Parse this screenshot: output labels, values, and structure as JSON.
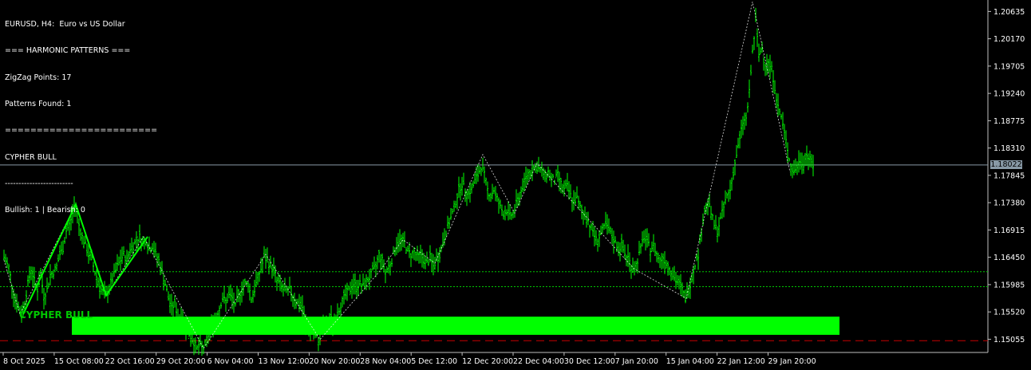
{
  "info": {
    "lines": [
      "EURUSD, H4:  Euro vs US Dollar",
      "=== HARMONIC PATTERNS ===",
      "ZigZag Points: 17",
      "Patterns Found: 1",
      "========================",
      "CYPHER BULL",
      "-------------------------",
      "Bullish: 1 | Bearish: 0"
    ]
  },
  "pattern": {
    "label": "CYPHER BULL"
  },
  "current_price": "1.18022",
  "y_axis": {
    "labels": [
      "1.20635",
      "1.20170",
      "1.19705",
      "1.19240",
      "1.18775",
      "1.18310",
      "1.17845",
      "1.17380",
      "1.16915",
      "1.16450",
      "1.15985",
      "1.15520",
      "1.15055"
    ]
  },
  "x_axis": {
    "labels": [
      "8 Oct 2025",
      "15 Oct 08:00",
      "22 Oct 16:00",
      "29 Oct 20:00",
      "6 Nov 04:00",
      "13 Nov 12:00",
      "20 Nov 20:00",
      "28 Nov 04:00",
      "5 Dec 12:00",
      "12 Dec 20:00",
      "22 Dec 04:00",
      "30 Dec 12:00",
      "7 Jan 20:00",
      "15 Jan 04:00",
      "22 Jan 12:00",
      "29 Jan 20:00"
    ]
  },
  "colors": {
    "background": "#000000",
    "bars": "#00ff00",
    "zone": "#00ff00",
    "dotted_levels": "#00c800",
    "sl_line": "#c80000",
    "price_line": "#8899a6",
    "zigzag": "#ffffff"
  },
  "chart_data": {
    "type": "candlestick",
    "symbol": "EURUSD",
    "timeframe": "H4",
    "ylim": [
      1.1483,
      1.2083
    ],
    "path": [
      [
        0,
        1.1645
      ],
      [
        6,
        1.1628
      ],
      [
        10,
        1.1598
      ],
      [
        14,
        1.1572
      ],
      [
        18,
        1.156
      ],
      [
        22,
        1.1548
      ],
      [
        26,
        1.1568
      ],
      [
        30,
        1.16
      ],
      [
        34,
        1.1625
      ],
      [
        38,
        1.1605
      ],
      [
        42,
        1.159
      ],
      [
        46,
        1.1615
      ],
      [
        50,
        1.158
      ],
      [
        54,
        1.159
      ],
      [
        58,
        1.1615
      ],
      [
        62,
        1.162
      ],
      [
        66,
        1.163
      ],
      [
        70,
        1.165
      ],
      [
        74,
        1.166
      ],
      [
        78,
        1.169
      ],
      [
        82,
        1.17
      ],
      [
        86,
        1.172
      ],
      [
        90,
        1.1735
      ],
      [
        94,
        1.17
      ],
      [
        98,
        1.168
      ],
      [
        102,
        1.1665
      ],
      [
        106,
        1.165
      ],
      [
        110,
        1.164
      ],
      [
        114,
        1.162
      ],
      [
        118,
        1.1605
      ],
      [
        122,
        1.159
      ],
      [
        126,
        1.158
      ],
      [
        130,
        1.1585
      ],
      [
        134,
        1.16
      ],
      [
        138,
        1.1615
      ],
      [
        142,
        1.163
      ],
      [
        146,
        1.164
      ],
      [
        150,
        1.165
      ],
      [
        154,
        1.164
      ],
      [
        158,
        1.166
      ],
      [
        162,
        1.1665
      ],
      [
        166,
        1.1675
      ],
      [
        170,
        1.168
      ],
      [
        174,
        1.167
      ],
      [
        178,
        1.1675
      ],
      [
        182,
        1.166
      ],
      [
        186,
        1.1665
      ],
      [
        190,
        1.165
      ],
      [
        194,
        1.164
      ],
      [
        198,
        1.162
      ],
      [
        202,
        1.16
      ],
      [
        206,
        1.1575
      ],
      [
        210,
        1.156
      ],
      [
        214,
        1.1565
      ],
      [
        218,
        1.1545
      ],
      [
        222,
        1.1545
      ],
      [
        226,
        1.153
      ],
      [
        230,
        1.152
      ],
      [
        234,
        1.151
      ],
      [
        238,
        1.15
      ],
      [
        242,
        1.149
      ],
      [
        246,
        1.1495
      ],
      [
        250,
        1.149
      ],
      [
        254,
        1.1505
      ],
      [
        258,
        1.152
      ],
      [
        262,
        1.1535
      ],
      [
        266,
        1.1545
      ],
      [
        270,
        1.156
      ],
      [
        274,
        1.1575
      ],
      [
        278,
        1.157
      ],
      [
        282,
        1.158
      ],
      [
        286,
        1.1575
      ],
      [
        290,
        1.156
      ],
      [
        294,
        1.158
      ],
      [
        298,
        1.159
      ],
      [
        302,
        1.16
      ],
      [
        306,
        1.16
      ],
      [
        310,
        1.1575
      ],
      [
        314,
        1.159
      ],
      [
        318,
        1.161
      ],
      [
        322,
        1.1625
      ],
      [
        326,
        1.1645
      ],
      [
        330,
        1.164
      ],
      [
        334,
        1.163
      ],
      [
        338,
        1.1625
      ],
      [
        342,
        1.1605
      ],
      [
        346,
        1.16
      ],
      [
        350,
        1.159
      ],
      [
        354,
        1.1585
      ],
      [
        358,
        1.159
      ],
      [
        362,
        1.158
      ],
      [
        366,
        1.157
      ],
      [
        370,
        1.1565
      ],
      [
        374,
        1.156
      ],
      [
        378,
        1.153
      ],
      [
        382,
        1.152
      ],
      [
        386,
        1.1525
      ],
      [
        390,
        1.151
      ],
      [
        394,
        1.1505
      ],
      [
        398,
        1.152
      ],
      [
        402,
        1.153
      ],
      [
        406,
        1.1525
      ],
      [
        410,
        1.154
      ],
      [
        414,
        1.153
      ],
      [
        418,
        1.155
      ],
      [
        422,
        1.1565
      ],
      [
        426,
        1.1575
      ],
      [
        430,
        1.1585
      ],
      [
        434,
        1.159
      ],
      [
        438,
        1.16
      ],
      [
        442,
        1.1595
      ],
      [
        446,
        1.16
      ],
      [
        450,
        1.1595
      ],
      [
        454,
        1.1605
      ],
      [
        458,
        1.161
      ],
      [
        462,
        1.162
      ],
      [
        466,
        1.163
      ],
      [
        470,
        1.165
      ],
      [
        474,
        1.164
      ],
      [
        478,
        1.162
      ],
      [
        482,
        1.163
      ],
      [
        486,
        1.164
      ],
      [
        490,
        1.166
      ],
      [
        494,
        1.167
      ],
      [
        498,
        1.1675
      ],
      [
        502,
        1.167
      ],
      [
        506,
        1.1655
      ],
      [
        510,
        1.165
      ],
      [
        514,
        1.1655
      ],
      [
        518,
        1.1645
      ],
      [
        522,
        1.165
      ],
      [
        526,
        1.164
      ],
      [
        530,
        1.1635
      ],
      [
        534,
        1.1645
      ],
      [
        538,
        1.163
      ],
      [
        542,
        1.164
      ],
      [
        546,
        1.165
      ],
      [
        550,
        1.167
      ],
      [
        554,
        1.169
      ],
      [
        558,
        1.1705
      ],
      [
        562,
        1.172
      ],
      [
        566,
        1.174
      ],
      [
        570,
        1.176
      ],
      [
        574,
        1.177
      ],
      [
        578,
        1.176
      ],
      [
        582,
        1.1755
      ],
      [
        586,
        1.176
      ],
      [
        590,
        1.1775
      ],
      [
        594,
        1.1785
      ],
      [
        598,
        1.18
      ],
      [
        602,
        1.1785
      ],
      [
        606,
        1.176
      ],
      [
        610,
        1.175
      ],
      [
        614,
        1.176
      ],
      [
        618,
        1.1745
      ],
      [
        622,
        1.173
      ],
      [
        626,
        1.172
      ],
      [
        630,
        1.1725
      ],
      [
        634,
        1.1715
      ],
      [
        638,
        1.172
      ],
      [
        642,
        1.1735
      ],
      [
        646,
        1.175
      ],
      [
        650,
        1.1765
      ],
      [
        654,
        1.178
      ],
      [
        658,
        1.179
      ],
      [
        662,
        1.1795
      ],
      [
        666,
        1.18
      ],
      [
        670,
        1.1795
      ],
      [
        674,
        1.179
      ],
      [
        678,
        1.1785
      ],
      [
        682,
        1.179
      ],
      [
        686,
        1.178
      ],
      [
        690,
        1.1775
      ],
      [
        694,
        1.1785
      ],
      [
        698,
        1.177
      ],
      [
        702,
        1.176
      ],
      [
        706,
        1.1765
      ],
      [
        710,
        1.175
      ],
      [
        714,
        1.174
      ],
      [
        718,
        1.1745
      ],
      [
        722,
        1.173
      ],
      [
        726,
        1.172
      ],
      [
        730,
        1.1715
      ],
      [
        734,
        1.17
      ],
      [
        738,
        1.169
      ],
      [
        742,
        1.1675
      ],
      [
        746,
        1.168
      ],
      [
        750,
        1.169
      ],
      [
        754,
        1.17
      ],
      [
        758,
        1.169
      ],
      [
        762,
        1.168
      ],
      [
        766,
        1.167
      ],
      [
        770,
        1.166
      ],
      [
        774,
        1.1665
      ],
      [
        778,
        1.165
      ],
      [
        782,
        1.1645
      ],
      [
        786,
        1.163
      ],
      [
        790,
        1.1625
      ],
      [
        794,
        1.164
      ],
      [
        798,
        1.166
      ],
      [
        802,
        1.168
      ],
      [
        806,
        1.167
      ],
      [
        810,
        1.166
      ],
      [
        814,
        1.1665
      ],
      [
        818,
        1.165
      ],
      [
        822,
        1.164
      ],
      [
        826,
        1.1645
      ],
      [
        830,
        1.1635
      ],
      [
        834,
        1.163
      ],
      [
        838,
        1.1615
      ],
      [
        842,
        1.1605
      ],
      [
        846,
        1.16
      ],
      [
        850,
        1.159
      ],
      [
        854,
        1.1575
      ],
      [
        858,
        1.159
      ],
      [
        862,
        1.161
      ],
      [
        866,
        1.1635
      ],
      [
        870,
        1.165
      ],
      [
        874,
        1.169
      ],
      [
        878,
        1.1725
      ],
      [
        882,
        1.174
      ],
      [
        886,
        1.172
      ],
      [
        890,
        1.17
      ],
      [
        894,
        1.169
      ],
      [
        898,
        1.171
      ],
      [
        902,
        1.173
      ],
      [
        906,
        1.175
      ],
      [
        910,
        1.176
      ],
      [
        914,
        1.179
      ],
      [
        918,
        1.182
      ],
      [
        922,
        1.1845
      ],
      [
        926,
        1.1875
      ],
      [
        930,
        1.188
      ],
      [
        934,
        1.1925
      ],
      [
        938,
        1.1995
      ],
      [
        942,
        1.2045
      ],
      [
        946,
        1.199
      ],
      [
        950,
        1.2
      ],
      [
        954,
        1.1975
      ],
      [
        958,
        1.1975
      ],
      [
        962,
        1.1965
      ],
      [
        966,
        1.1935
      ],
      [
        970,
        1.19
      ],
      [
        974,
        1.1885
      ],
      [
        978,
        1.1855
      ],
      [
        982,
        1.183
      ],
      [
        986,
        1.18
      ],
      [
        990,
        1.179
      ],
      [
        994,
        1.18
      ],
      [
        998,
        1.181
      ],
      [
        1002,
        1.1805
      ],
      [
        1006,
        1.182
      ],
      [
        1010,
        1.181
      ],
      [
        1014,
        1.1802
      ]
    ],
    "zigzag_points": [
      [
        0,
        1.164
      ],
      [
        20,
        1.1548
      ],
      [
        90,
        1.1735
      ],
      [
        128,
        1.158
      ],
      [
        175,
        1.168
      ],
      [
        250,
        1.149
      ],
      [
        328,
        1.165
      ],
      [
        396,
        1.1505
      ],
      [
        470,
        1.162
      ],
      [
        500,
        1.1675
      ],
      [
        540,
        1.1635
      ],
      [
        600,
        1.182
      ],
      [
        640,
        1.172
      ],
      [
        668,
        1.1805
      ],
      [
        790,
        1.1625
      ],
      [
        855,
        1.1575
      ],
      [
        938,
        1.208
      ],
      [
        985,
        1.179
      ]
    ],
    "pattern_points": [
      [
        24,
        1.1548
      ],
      [
        90,
        1.1735
      ],
      [
        128,
        1.158
      ],
      [
        180,
        1.168
      ]
    ],
    "zone": {
      "x": [
        90,
        1052
      ],
      "low": 1.1513,
      "high": 1.1544
    },
    "levels": [
      1.16205,
      1.1595
    ],
    "stop_line": 1.1503,
    "current_price_value": 1.18022
  }
}
